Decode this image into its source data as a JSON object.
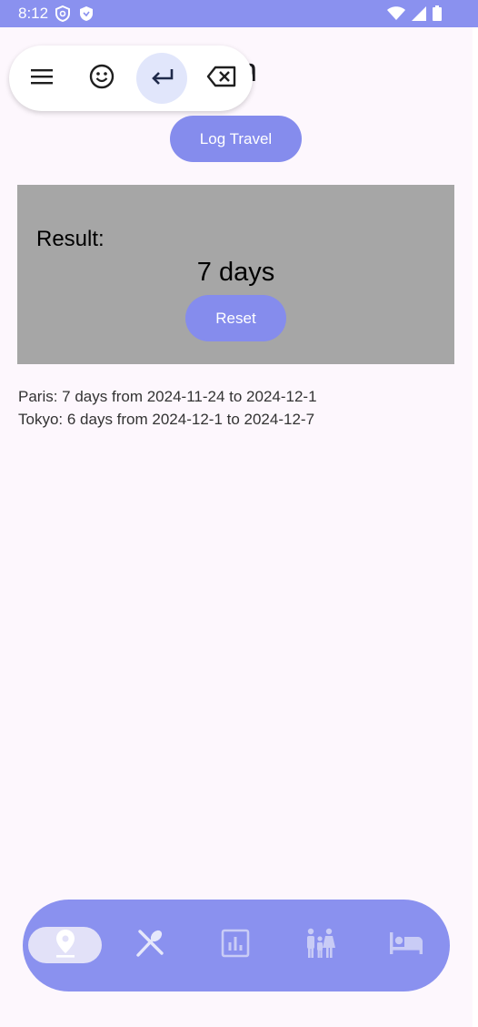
{
  "status_bar": {
    "time": "8:12",
    "left_icons": [
      "shield-outline-icon",
      "shield-filled-icon"
    ],
    "right_icons": [
      "wifi-icon",
      "signal-icon",
      "battery-icon"
    ],
    "bg_color": "#8a91ef"
  },
  "header": {
    "title_visible_text": "ation"
  },
  "ime_toolbar": {
    "buttons": [
      {
        "icon": "menu-icon",
        "active": false
      },
      {
        "icon": "emoji-icon",
        "active": false
      },
      {
        "icon": "enter-arrow-icon",
        "active": true
      },
      {
        "icon": "backspace-icon",
        "active": false
      }
    ]
  },
  "actions": {
    "log_label": "Log Travel"
  },
  "result": {
    "label": "Result:",
    "value": "7 days",
    "reset_label": "Reset"
  },
  "travel_log": {
    "entries": [
      "Paris: 7 days from 2024-11-24 to 2024-12-1",
      "Tokyo: 6 days from 2024-12-1 to 2024-12-7"
    ]
  },
  "bottom_nav": {
    "items": [
      {
        "icon": "location-pin-icon",
        "selected": true
      },
      {
        "icon": "utensils-icon",
        "selected": false
      },
      {
        "icon": "bar-chart-icon",
        "selected": false
      },
      {
        "icon": "family-icon",
        "selected": false
      },
      {
        "icon": "bed-icon",
        "selected": false
      }
    ],
    "accent_color": "#8a91ef"
  }
}
